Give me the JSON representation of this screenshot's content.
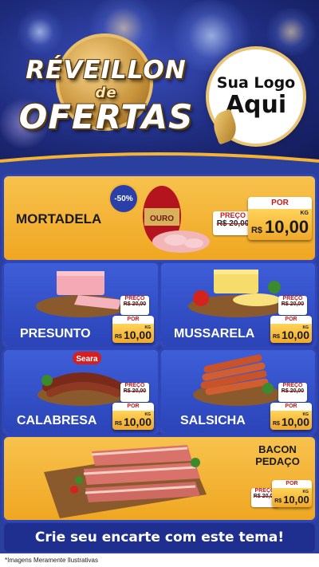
{
  "header": {
    "title_line1": "RÉVEILLON",
    "title_line2": "de",
    "title_line3": "OFERTAS",
    "logo_line1": "Sua Logo",
    "logo_line2": "Aqui"
  },
  "badge": "-50%",
  "products": [
    {
      "name": "MORTADELA",
      "preco_label": "PREÇO",
      "old_price": "R$ 20,00",
      "por_label": "POR",
      "currency": "R$",
      "price": "10,00",
      "unit": "KG",
      "brand": "OURO"
    },
    {
      "name": "PRESUNTO",
      "preco_label": "PREÇO",
      "old_price": "R$ 20,00",
      "por_label": "POR",
      "currency": "R$",
      "price": "10,00",
      "unit": "KG"
    },
    {
      "name": "MUSSARELA",
      "preco_label": "PREÇO",
      "old_price": "R$ 20,00",
      "por_label": "POR",
      "currency": "R$",
      "price": "10,00",
      "unit": "KG"
    },
    {
      "name": "CALABRESA",
      "preco_label": "PREÇO",
      "old_price": "R$ 20,00",
      "por_label": "POR",
      "currency": "R$",
      "price": "10,00",
      "unit": "KG",
      "brand": "Seara"
    },
    {
      "name": "SALSICHA",
      "preco_label": "PREÇO",
      "old_price": "R$ 20,00",
      "por_label": "POR",
      "currency": "R$",
      "price": "10,00",
      "unit": "KG"
    },
    {
      "name_line1": "BACON",
      "name_line2": "PEDAÇO",
      "preco_label": "PREÇO",
      "old_price": "R$ 20,00",
      "por_label": "POR",
      "currency": "R$",
      "price": "10,00",
      "unit": "KG"
    }
  ],
  "cta": "Crie seu encarte com este tema!",
  "disclaimer": "*Imagens Meramente Ilustrativas",
  "colors": {
    "gold": "#f5b233",
    "blue": "#2b44b8",
    "red": "#c61a1a"
  }
}
